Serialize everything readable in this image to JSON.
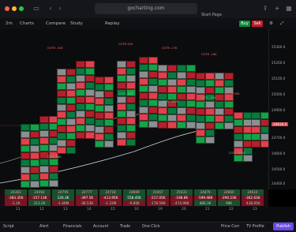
{
  "browser": {
    "url": "gocharting.com",
    "tab_label": "Start Page"
  },
  "toolbar": {
    "timeframe": "2m",
    "charts": "Charts",
    "compare": "Compare",
    "study": "Study",
    "replay": "Replay",
    "buy": "Buy",
    "sell": "Sell"
  },
  "price_axis": {
    "ticks": [
      "25300.0",
      "25200.0",
      "25100.0",
      "25000.0",
      "24900.0",
      "24800.0",
      "24700.0",
      "24600.0",
      "24500.0",
      "24400.0"
    ],
    "last": "24616.0"
  },
  "dates": [
    "11",
    "12",
    "13",
    "14",
    "15",
    "16",
    "19",
    "20",
    "21",
    "22",
    "23"
  ],
  "stats": {
    "top": [
      "24363",
      "24092",
      "24795",
      "24777",
      "24718",
      "24899",
      "25067",
      "25033",
      "24876",
      "24860",
      "24624"
    ],
    "mid": [
      "-383.35K",
      "-157.13K",
      "126.3K",
      "-397.5K",
      "-413.95K",
      "558.45K",
      "-217.05K",
      "-198.6K",
      "-599.48K",
      "-290.23K",
      "-362.63K"
    ],
    "low": [
      "-1.1K",
      "313.2K",
      "-1.49M",
      "-36.53K",
      "-1.33M",
      "-9.85K",
      "-178.59K",
      "-474.09K",
      "486.3K",
      "99K",
      "-438.05K"
    ]
  },
  "bottom": {
    "script": "Script",
    "alert": "Alert",
    "financials": "Financials",
    "account": "Account",
    "trade": "Trade",
    "one_click": "One Click",
    "price_corr": "Price Corr",
    "tv_profile": "TV Profile",
    "publish": "Publish"
  },
  "cot_labels": [
    "COTH -31K",
    "COTL 34K",
    "COTH 42K",
    "COTL -81K",
    "COTH -17K",
    "COTL -101K",
    "COTH -16K",
    "COTL -85K",
    "COTH 35K",
    "COTL -231K"
  ]
}
